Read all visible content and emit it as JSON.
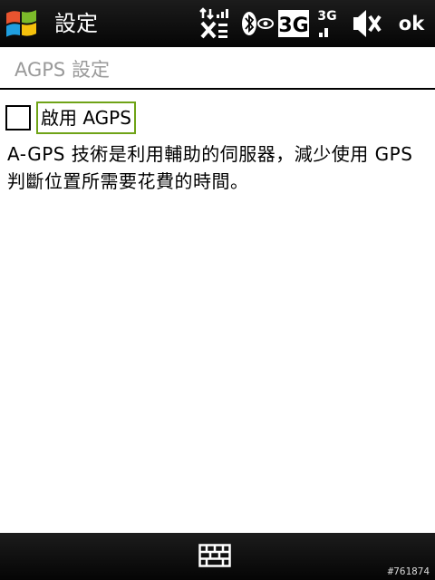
{
  "titlebar": {
    "title": "設定",
    "ok_label": "ok",
    "icons": [
      "windows-start-icon",
      "signal-off-icon",
      "bluetooth-visible-icon",
      "3g-icon",
      "3g-signal-icon",
      "volume-mute-icon"
    ]
  },
  "page": {
    "heading": "AGPS 設定"
  },
  "agps": {
    "checkbox_label": "啟用 AGPS",
    "checked": false,
    "description": "A-GPS 技術是利用輔助的伺服器，減少使用 GPS 判斷位置所需要花費的時間。"
  },
  "softkeys": {
    "icon": "keyboard-icon"
  },
  "watermark": "#761874",
  "colors": {
    "bar_background": "#0a0a0a",
    "heading_text": "#9a9a9a",
    "focus_border": "#6fa317",
    "text": "#000000"
  }
}
